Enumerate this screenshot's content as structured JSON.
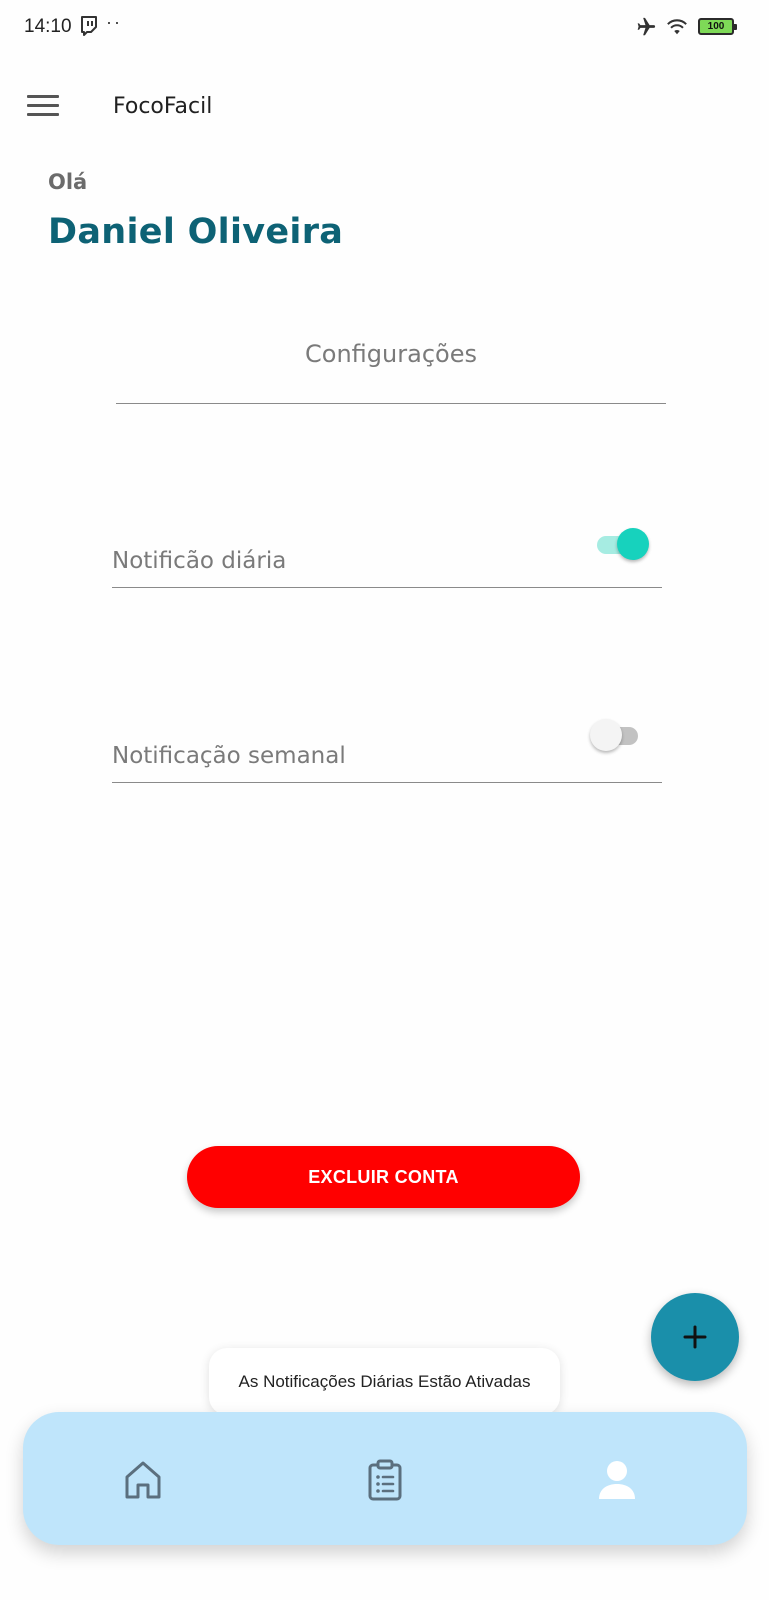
{
  "status_bar": {
    "time": "14:10",
    "dots": "··",
    "battery": "100",
    "icons": [
      "twitch-icon",
      "airplane-mode-icon",
      "wifi-icon",
      "battery-icon"
    ]
  },
  "app_bar": {
    "title": "FocoFacil",
    "menu_icon": "hamburger-menu-icon"
  },
  "greeting": {
    "hello": "Olá",
    "user_name": "Daniel Oliveira"
  },
  "settings": {
    "title": "Configurações",
    "daily_notification": {
      "label": "Notificão diária",
      "enabled": true
    },
    "weekly_notification": {
      "label": "Notificação semanal",
      "enabled": false
    }
  },
  "delete_button": {
    "label": "EXCLUIR CONTA"
  },
  "fab": {
    "icon": "plus-icon"
  },
  "toast": {
    "message": "As Notificações Diárias Estão Ativadas"
  },
  "bottom_nav": {
    "items": [
      {
        "icon": "home-icon",
        "active": false
      },
      {
        "icon": "clipboard-list-icon",
        "active": false
      },
      {
        "icon": "user-icon",
        "active": true
      }
    ]
  },
  "colors": {
    "accent": "#0d6275",
    "toggle_on": "#17d2bd",
    "danger": "#ff0000",
    "fab": "#1a8faa",
    "nav_background": "#bfe5fb"
  }
}
